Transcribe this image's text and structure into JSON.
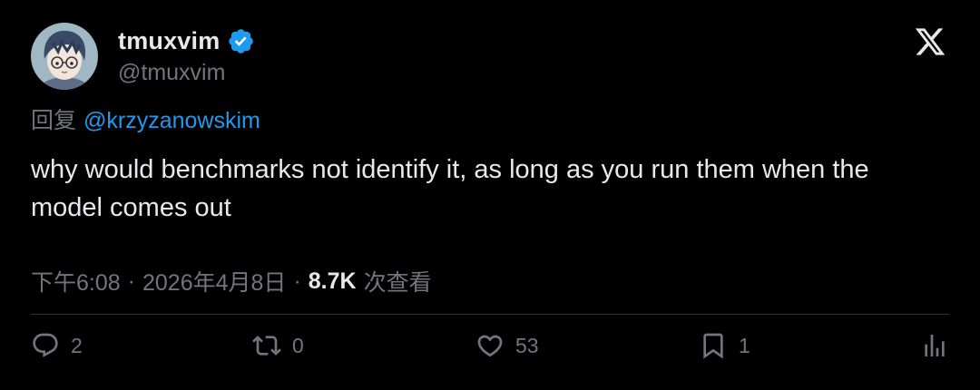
{
  "author": {
    "display_name": "tmuxvim",
    "handle": "@tmuxvim",
    "verified_icon": "verified-badge-icon",
    "avatar_icon": "avatar"
  },
  "platform_icon": "x-logo-icon",
  "reply": {
    "prefix": "回复",
    "mention": "@krzyzanowskim"
  },
  "tweet": {
    "text": "why would benchmarks not identify it, as long as you run them when the model comes out"
  },
  "meta": {
    "time": "下午6:08",
    "separator": "·",
    "date": "2026年4月8日",
    "views_count": "8.7K",
    "views_label": "次查看"
  },
  "actions": {
    "reply": {
      "icon": "reply-icon",
      "count": "2"
    },
    "repost": {
      "icon": "repost-icon",
      "count": "0"
    },
    "like": {
      "icon": "heart-icon",
      "count": "53"
    },
    "bookmark": {
      "icon": "bookmark-icon",
      "count": "1"
    },
    "analytics": {
      "icon": "analytics-icon"
    }
  },
  "colors": {
    "background": "#000000",
    "text": "#e7e9ea",
    "secondary": "#71767b",
    "accent": "#1d9bf0",
    "divider": "#2f3336"
  }
}
